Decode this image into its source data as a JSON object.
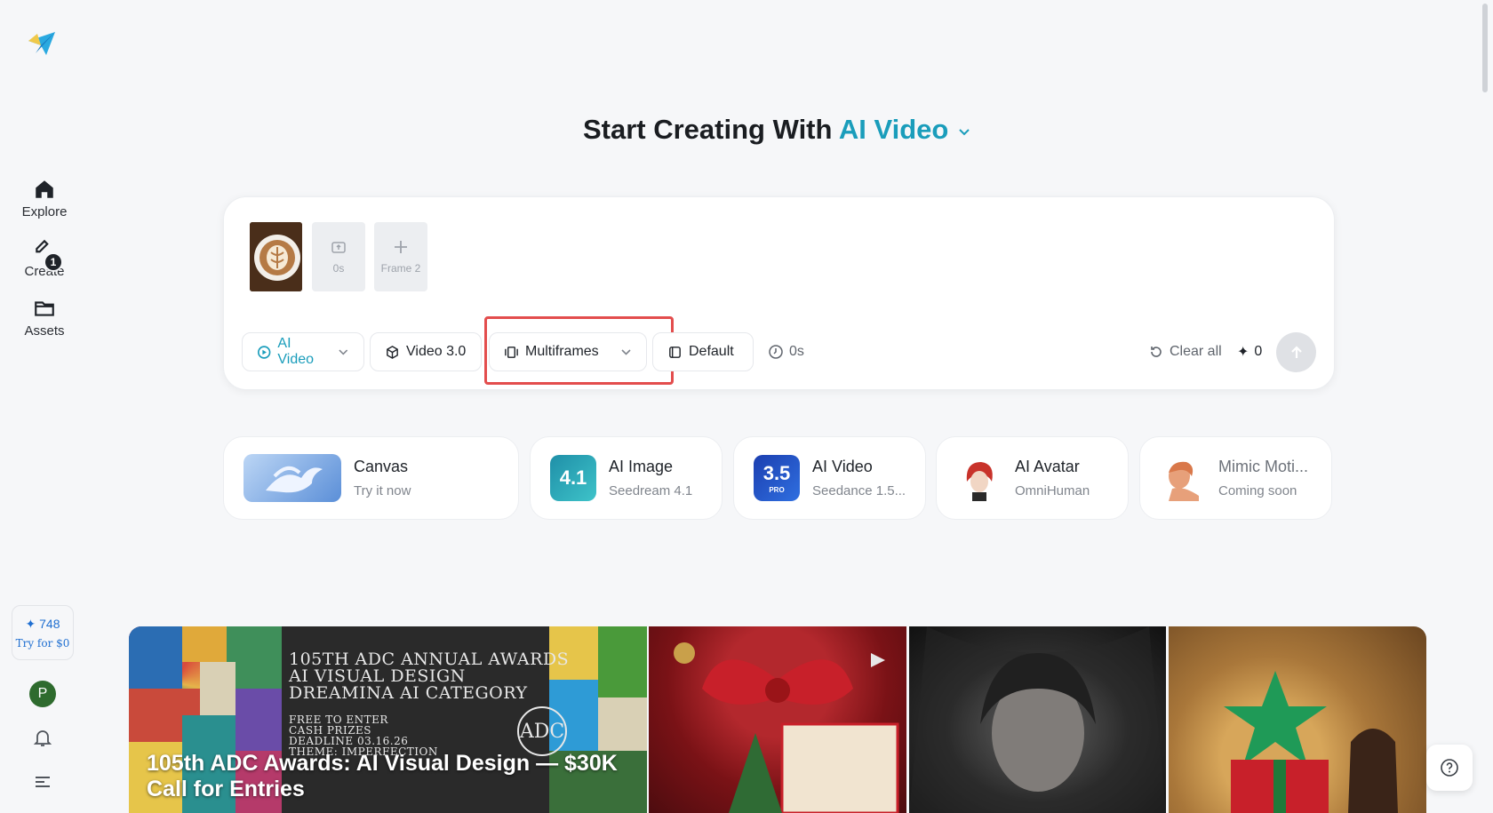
{
  "sidebar": {
    "nav": [
      {
        "label": "Explore",
        "icon": "home-icon"
      },
      {
        "label": "Create",
        "icon": "create-icon",
        "badge": "1"
      },
      {
        "label": "Assets",
        "icon": "folder-icon"
      }
    ],
    "credits": {
      "value": "748",
      "try_label": "Try for $0"
    },
    "avatar_initial": "P"
  },
  "heading": {
    "prefix": "Start Creating With ",
    "accent": "AI Video"
  },
  "composer": {
    "frames": [
      {
        "label": "0s"
      },
      {
        "label": "Frame 2"
      }
    ],
    "chips": {
      "mode": "AI Video",
      "model": "Video 3.0",
      "reference": "Multiframes",
      "ratio": "Default",
      "duration": "0s"
    },
    "clear_label": "Clear all",
    "cost": "0"
  },
  "tools": [
    {
      "title": "Canvas",
      "subtitle": "Try it now",
      "icon": "canvas-pegasus-icon"
    },
    {
      "title": "AI Image",
      "subtitle": "Seedream 4.1",
      "icon": "seedream-icon",
      "icon_text": "4.1"
    },
    {
      "title": "AI Video",
      "subtitle": "Seedance 1.5...",
      "icon": "seedance-icon",
      "icon_text": "3.5",
      "icon_sub": "PRO"
    },
    {
      "title": "AI Avatar",
      "subtitle": "OmniHuman",
      "icon": "avatar-icon"
    },
    {
      "title": "Mimic Moti...",
      "subtitle": "Coming soon",
      "icon": "mimic-icon"
    }
  ],
  "gallery": {
    "banner": {
      "lines": [
        "105TH ADC ANNUAL AWARDS",
        "AI VISUAL DESIGN",
        "DREAMINA AI CATEGORY"
      ],
      "small_lines": [
        "FREE TO ENTER",
        "CASH PRIZES",
        "DEADLINE 03.16.26",
        "THEME: IMPERFECTION"
      ],
      "logo": "ADC",
      "title_line1": "105th ADC Awards: AI Visual Design — $30K",
      "title_line2": "Call for Entries"
    }
  },
  "colors": {
    "accent": "#1a9dbb",
    "highlight": "#e34d4d",
    "credits": "#1f6fd1"
  }
}
